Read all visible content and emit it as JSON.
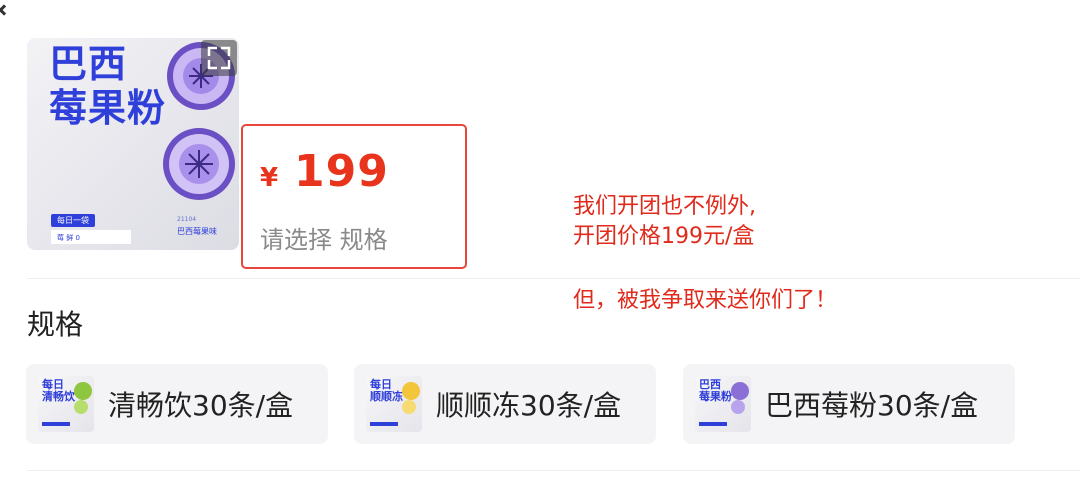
{
  "product": {
    "image_title_line1": "巴西",
    "image_title_line2": "莓果粉",
    "image_badge": "每日一袋",
    "image_strip": "莓 鲜 0",
    "image_brand": "巴西莓果味",
    "image_small": "21104"
  },
  "price": {
    "currency": "¥",
    "value": "199",
    "hint": "请选择 规格"
  },
  "annotation": {
    "line1": "我们开团也不例外,",
    "line2": "开团价格199元/盒",
    "line3": "但，被我争取来送你们了！"
  },
  "spec": {
    "section_label": "规格",
    "options": [
      {
        "thumb_title": "每日\n清畅饮",
        "label": "清畅饮30条/盒",
        "accent": "#8fc640"
      },
      {
        "thumb_title": "每日\n顺顺冻",
        "label": "顺顺冻30条/盒",
        "accent": "#f2c53a"
      },
      {
        "thumb_title": "巴西\n莓果粉",
        "label": "巴西莓粉30条/盒",
        "accent": "#8a6fd6"
      }
    ]
  },
  "colors": {
    "price_red": "#e8341c",
    "annotation_red": "#e02a1b",
    "brand_blue": "#2f3fd9"
  },
  "icons": {
    "expand": "expand-icon"
  }
}
